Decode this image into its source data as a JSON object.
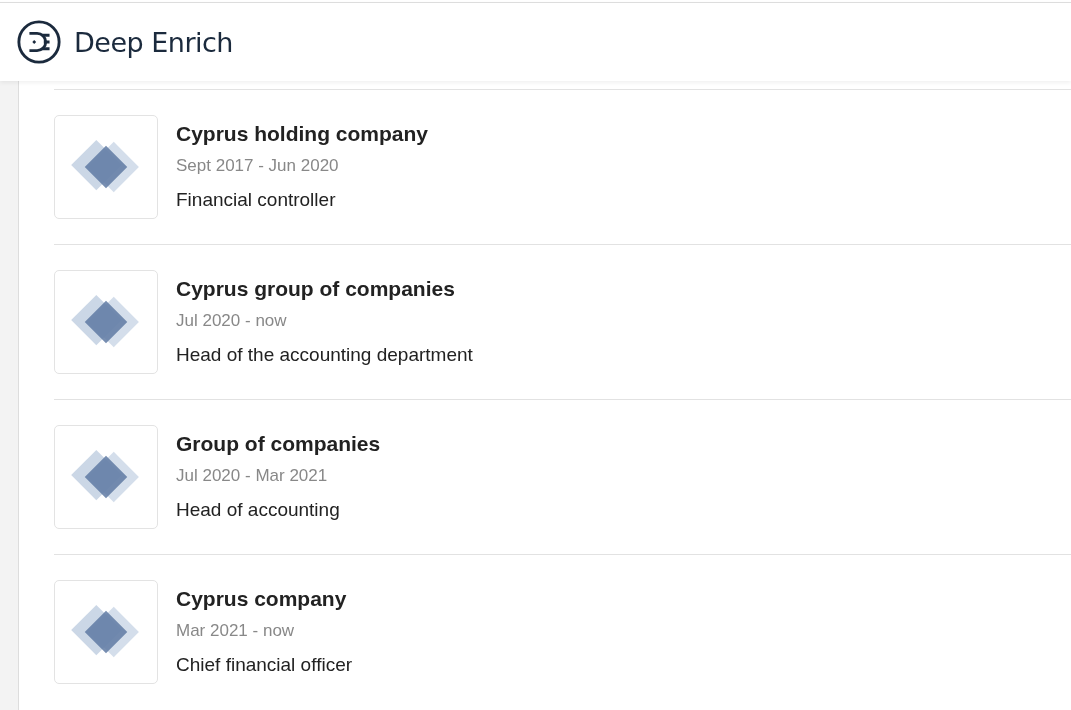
{
  "header": {
    "brand": "Deep Enrich"
  },
  "experience": [
    {
      "company": "Cyprus holding company",
      "period": "Sept 2017 - Jun 2020",
      "role": "Financial controller"
    },
    {
      "company": "Cyprus group of companies",
      "period": "Jul 2020 - now",
      "role": "Head of the accounting department"
    },
    {
      "company": "Group of companies",
      "period": "Jul 2020 - Mar 2021",
      "role": "Head of accounting"
    },
    {
      "company": "Cyprus company",
      "period": "Mar 2021 - now",
      "role": "Chief financial officer"
    }
  ]
}
